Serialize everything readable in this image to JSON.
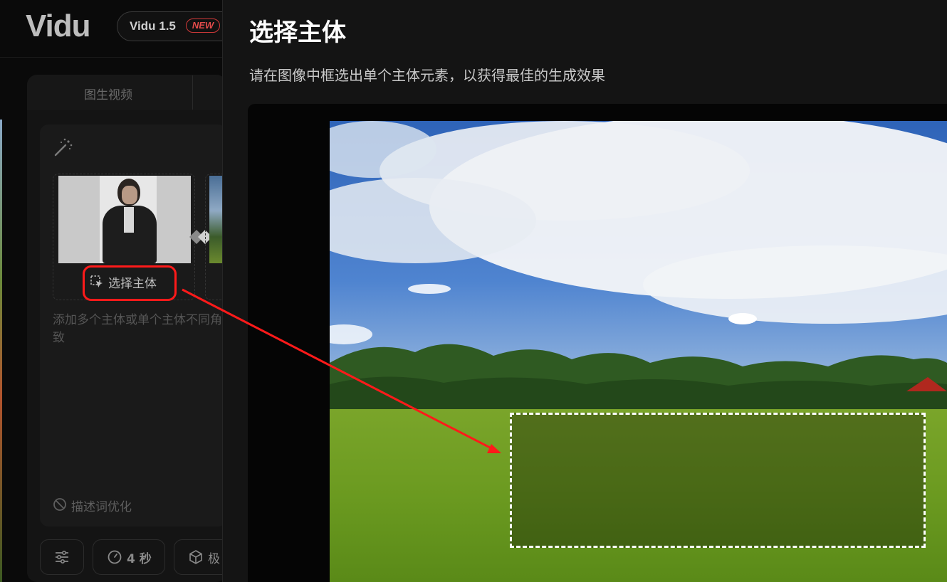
{
  "app": {
    "logo": "Vidu",
    "version_label": "Vidu 1.5",
    "new_badge": "NEW"
  },
  "tabs": {
    "img2video": "图生视频"
  },
  "subject_panel": {
    "select_subject_label": "选择主体",
    "hint": "添加多个主体或单个主体不同角度的图片，以保持生成结果的一致",
    "hint_visible": "添加多个主体或单个主体不同角\n致",
    "prompt_optimize_label": "描述词优化"
  },
  "controls": {
    "duration_label": "4 秒",
    "quality_label": "极"
  },
  "modal": {
    "title": "选择主体",
    "subtitle": "请在图像中框选出单个主体元素，以获得最佳的生成效果"
  },
  "icons": {
    "wand": "magic-wand-icon",
    "swap": "swap-diamond-icon",
    "select": "select-region-icon",
    "optimize": "no-entry-icon",
    "settings": "sliders-icon",
    "clock": "clock-icon",
    "cube": "cube-icon"
  },
  "colors": {
    "accent_red": "#ff1a1a",
    "new_badge_red": "#e24b4b",
    "modal_bg": "#141414",
    "app_bg": "#0a0a0a"
  }
}
